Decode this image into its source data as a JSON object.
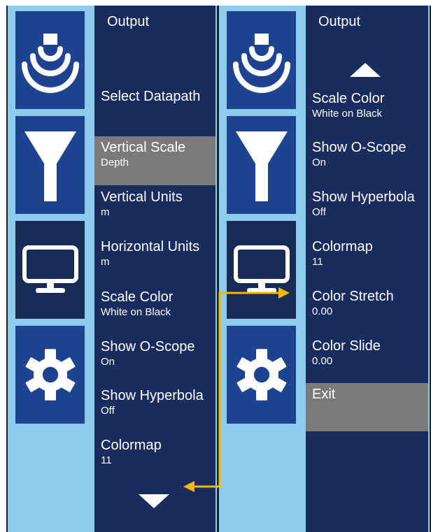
{
  "accent_color": "#f5b800",
  "left_menu": {
    "title": "Output",
    "items": [
      {
        "label": "Select Datapath",
        "value": ""
      },
      {
        "label": "Vertical Scale",
        "value": "Depth"
      },
      {
        "label": "Vertical Units",
        "value": "m"
      },
      {
        "label": "Horizontal Units",
        "value": "m"
      },
      {
        "label": "Scale Color",
        "value": "White on Black"
      },
      {
        "label": "Show O-Scope",
        "value": "On"
      },
      {
        "label": "Show Hyperbola",
        "value": "Off"
      },
      {
        "label": "Colormap",
        "value": "11"
      }
    ],
    "selected": "Vertical Scale",
    "scroll_indicator": "chevron-down"
  },
  "right_menu": {
    "title": "Output",
    "items": [
      {
        "label": "Scale Color",
        "value": "White on Black"
      },
      {
        "label": "Show O-Scope",
        "value": "On"
      },
      {
        "label": "Show Hyperbola",
        "value": "Off"
      },
      {
        "label": "Colormap",
        "value": "11"
      },
      {
        "label": "Color Stretch",
        "value": "0.00"
      },
      {
        "label": "Color Slide",
        "value": "0.00"
      },
      {
        "label": "Exit",
        "value": ""
      }
    ],
    "selected": "Exit",
    "scroll_indicator": "chevron-up"
  },
  "sidebar_icons": [
    "antenna-waves-icon",
    "filter-funnel-icon",
    "monitor-icon",
    "gear-icon"
  ]
}
